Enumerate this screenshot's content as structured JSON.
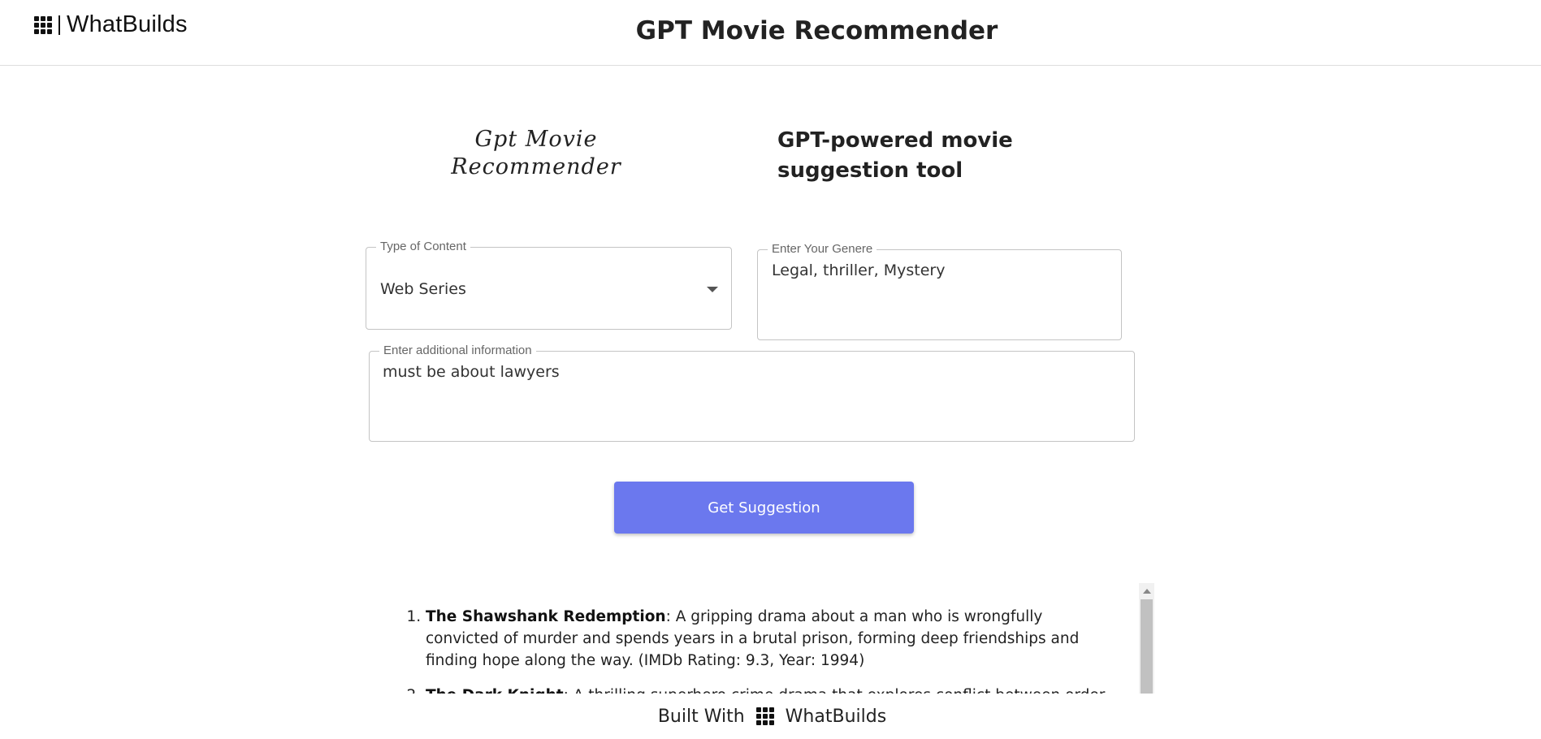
{
  "header": {
    "brand_name": "WhatBuilds",
    "title": "GPT Movie Recommender"
  },
  "hero": {
    "logo_text": "Gpt Movie Recommender",
    "tagline": "GPT-powered movie suggestion tool"
  },
  "form": {
    "content_type": {
      "label": "Type of Content",
      "value": "Web Series"
    },
    "genre": {
      "label": "Enter Your Genere",
      "value": "Legal, thriller, Mystery"
    },
    "additional_info": {
      "label": "Enter additional information",
      "value": "must be about lawyers"
    },
    "submit_label": "Get Suggestion"
  },
  "results": [
    {
      "title": "The Shawshank Redemption",
      "description": ": A gripping drama about a man who is wrongfully convicted of murder and spends years in a brutal prison, forming deep friendships and finding hope along the way. (IMDb Rating: 9.3, Year: 1994)"
    },
    {
      "title": "The Dark Knight",
      "description": ": A thrilling superhero crime drama that explores conflict between order and chaos."
    }
  ],
  "footer": {
    "built_with": "Built With",
    "brand_name": "WhatBuilds"
  },
  "colors": {
    "primary_button": "#6b78ee",
    "border": "#c4c4c4"
  }
}
